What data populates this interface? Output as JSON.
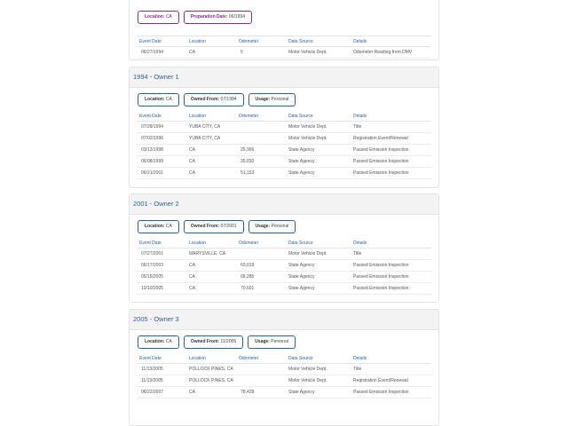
{
  "top_section": {
    "chips": [
      "Location:",
      "CA",
      "Preparation Date:",
      "06/1994"
    ],
    "headers": [
      "Event Date",
      "Location",
      "Odometer",
      "Data Source",
      "Details"
    ],
    "rows": [
      [
        "06/27/1994",
        "CA",
        "5",
        "Motor Vehicle Dept.",
        "Odometer Reading from DMV"
      ]
    ]
  },
  "owner1": {
    "title": "1994 - Owner   1",
    "chips": [
      "Location:",
      "CA",
      "Owned From:",
      "07/1994",
      "Usage:",
      "Personal"
    ],
    "headers": [
      "Event Date",
      "Location",
      "Odometer",
      "Data Source",
      "Details"
    ],
    "rows": [
      [
        "07/28/1994",
        "YUBA CITY, CA",
        "",
        "Motor Vehicle Dept.",
        "Title"
      ],
      [
        "07/02/1996",
        "YUBA CITY, CA",
        "",
        "Motor Vehicle Dept.",
        "Registration Event/Renewal"
      ],
      [
        "03/13/1998",
        "CA",
        "25,956",
        "State Agency",
        "Passed Emission Inspection"
      ],
      [
        "06/08/1999",
        "CA",
        "35,830",
        "State Agency",
        "Passed Emission Inspection"
      ],
      [
        "06/21/2001",
        "CA",
        "51,153",
        "State Agency",
        "Passed Emission Inspection"
      ]
    ]
  },
  "owner2": {
    "title": "2001 - Owner   2",
    "chips": [
      "Location:",
      "CA",
      "Owned From:",
      "07/2001",
      "Usage:",
      "Personal"
    ],
    "headers": [
      "Event Date",
      "Location",
      "Odometer",
      "Data Source",
      "Details"
    ],
    "rows": [
      [
        "07/27/2001",
        "MARYSVILLE, CA",
        "",
        "Motor Vehicle Dept.",
        "Title"
      ],
      [
        "06/17/2003",
        "CA",
        "60,019",
        "State Agency",
        "Passed Emission Inspection"
      ],
      [
        "05/16/2005",
        "CA",
        "68,285",
        "State Agency",
        "Passed Emission Inspection"
      ],
      [
        "10/10/2005",
        "CA",
        "70,691",
        "State Agency",
        "Passed Emission Inspection"
      ]
    ]
  },
  "owner3": {
    "title": "2005 - Owner   3",
    "chips": [
      "Location:",
      "CA",
      "Owned From:",
      "11/2005",
      "Usage:",
      "Personal"
    ],
    "headers": [
      "Event Date",
      "Location",
      "Odometer",
      "Data Source",
      "Details"
    ],
    "rows": [
      [
        "11/13/2005",
        "POLLOCK PINES, CA",
        "",
        "Motor Vehicle Dept.",
        "Title"
      ],
      [
        "11/13/2005",
        "POLLOCK PINES, CA",
        "",
        "Motor Vehicle Dept.",
        "Registration Event/Renewal"
      ],
      [
        "06/22/2007",
        "CA",
        "78,428",
        "State Agency",
        "Passed Emission Inspection"
      ]
    ]
  }
}
